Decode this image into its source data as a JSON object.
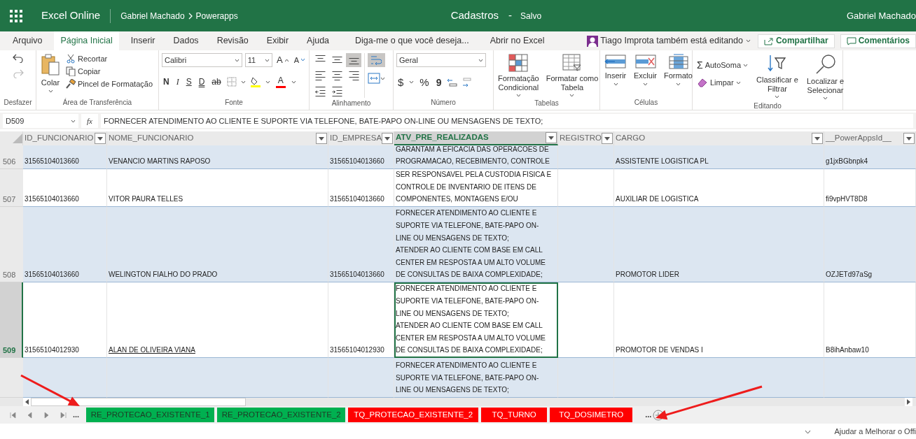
{
  "app_bar": {
    "app_name": "Excel Online",
    "breadcrumb": [
      "Gabriel Machado",
      "Powerapps"
    ],
    "document": "Cadastros",
    "separator": "-",
    "save_status": "Salvo",
    "user": "Gabriel Machado"
  },
  "menu_tabs": [
    {
      "label": "Arquivo",
      "selected": false
    },
    {
      "label": "Página Inicial",
      "selected": true
    },
    {
      "label": "Inserir",
      "selected": false
    },
    {
      "label": "Dados",
      "selected": false
    },
    {
      "label": "Revisão",
      "selected": false
    },
    {
      "label": "Exibir",
      "selected": false
    },
    {
      "label": "Ajuda",
      "selected": false
    }
  ],
  "tell_me": "Diga-me o que você deseja...",
  "open_in_desktop": "Abrir no Excel",
  "coauthor": "Tiago Improta também está editando",
  "share_button": "Compartilhar",
  "comments_button": "Comentários",
  "ribbon": {
    "undo": {
      "group": "Desfazer"
    },
    "clipboard": {
      "paste": "Colar",
      "cut": "Recortar",
      "copy": "Copiar",
      "format_painter": "Pincel de Formatação",
      "group": "Área de Transferência"
    },
    "font": {
      "font_name": "Calibri",
      "font_size": "11",
      "grow": "A",
      "shrink": "A",
      "format_buttons": [
        "N",
        "I",
        "S",
        "D",
        "ab"
      ],
      "font_color": "A",
      "group": "Fonte"
    },
    "alignment": {
      "buttons": [
        {
          "kind": "top",
          "selected": false
        },
        {
          "kind": "middle",
          "selected": false
        },
        {
          "kind": "bottom",
          "selected": true
        },
        {
          "kind": "left",
          "selected": false
        },
        {
          "kind": "center",
          "selected": false
        },
        {
          "kind": "right",
          "selected": false
        },
        {
          "kind": "outdent",
          "selected": false
        },
        {
          "kind": "indent",
          "selected": false
        }
      ],
      "wrap_text_selected": true,
      "group": "Alinhamento"
    },
    "number": {
      "format": "Geral",
      "currency": "$",
      "percent": "%",
      "comma": "9",
      "group": "Número"
    },
    "tables": {
      "conditional": [
        "Formatação",
        "Condicional"
      ],
      "format_table": [
        "Formatar como",
        "Tabela"
      ],
      "group": "Tabelas"
    },
    "cells": {
      "insert": "Inserir",
      "delete": "Excluir",
      "format": "Formato",
      "group": "Células"
    },
    "editing": {
      "sum_symbol": "Σ",
      "autosum": "AutoSoma",
      "clear": "Limpar",
      "sort": [
        "Classificar e",
        "Filtrar"
      ],
      "find": [
        "Localizar e",
        "Selecionar"
      ],
      "group": "Editando"
    }
  },
  "formula_bar": {
    "name_box": "D509",
    "function_label": "fx",
    "formula": "FORNECER  ATENDIMENTO AO CLIENTE E SUPORTE VIA TELEFONE, BATE-PAPO ON-LINE OU MENSAGENS DE TEXTO;"
  },
  "table": {
    "columns": [
      {
        "label": "ID_FUNCIONARIO",
        "selected": false
      },
      {
        "label": "NOME_FUNCIONARIO",
        "selected": false
      },
      {
        "label": "ID_EMPRESA",
        "selected": false
      },
      {
        "label": "ATV_PRE_REALIZADAS",
        "selected": true
      },
      {
        "label": "REGISTRO",
        "selected": false
      },
      {
        "label": "CARGO",
        "selected": false
      },
      {
        "label": "__PowerAppsId__",
        "selected": false
      }
    ],
    "rows": [
      {
        "number": "506",
        "selected": false,
        "shaded": true,
        "cells": [
          {
            "lines": [
              "31565104013660"
            ],
            "underlined": false,
            "selected": false
          },
          {
            "lines": [
              "VENANCIO MARTINS RAPOSO"
            ],
            "underlined": false,
            "selected": false
          },
          {
            "lines": [
              "31565104013660"
            ],
            "underlined": false,
            "selected": false
          },
          {
            "lines": [
              "GARANTAM A EFICACIA DAS OPERACOES DE",
              "PROGRAMACAO, RECEBIMENTO, CONTROLE"
            ],
            "underlined": false,
            "selected": false
          },
          null,
          {
            "lines": [
              "ASSISTENTE LOGISTICA PL"
            ],
            "underlined": false,
            "selected": false
          },
          {
            "lines": [
              "g1jxBGbnpk4"
            ],
            "underlined": false,
            "selected": false
          }
        ]
      },
      {
        "number": "507",
        "selected": false,
        "shaded": false,
        "cells": [
          {
            "lines": [
              "31565104013660"
            ],
            "underlined": false,
            "selected": false
          },
          {
            "lines": [
              "VITOR PAURA TELLES"
            ],
            "underlined": false,
            "selected": false
          },
          {
            "lines": [
              "31565104013660"
            ],
            "underlined": false,
            "selected": false
          },
          {
            "lines": [
              "SER RESPONSAVEL PELA CUSTODIA FISICA E",
              "CONTROLE DE INVENTARIO DE ITENS DE",
              "COMPONENTES, MONTAGENS E/OU"
            ],
            "underlined": false,
            "selected": false
          },
          null,
          {
            "lines": [
              "AUXILIAR DE LOGISTICA"
            ],
            "underlined": false,
            "selected": false
          },
          {
            "lines": [
              "fi9vpHVT8D8"
            ],
            "underlined": false,
            "selected": false
          }
        ]
      },
      {
        "number": "508",
        "selected": false,
        "shaded": true,
        "cells": [
          {
            "lines": [
              "31565104013660"
            ],
            "underlined": false,
            "selected": false
          },
          {
            "lines": [
              "WELINGTON FIALHO DO PRADO"
            ],
            "underlined": false,
            "selected": false
          },
          {
            "lines": [
              "31565104013660"
            ],
            "underlined": false,
            "selected": false
          },
          {
            "lines": [
              "FORNECER  ATENDIMENTO AO CLIENTE E",
              "SUPORTE VIA TELEFONE, BATE-PAPO ON-",
              "LINE OU MENSAGENS DE TEXTO;",
              "ATENDER AO CLIENTE COM BASE EM CALL",
              "CENTER EM RESPOSTA A UM ALTO VOLUME",
              "DE CONSULTAS DE BAIXA COMPLEXIDADE;"
            ],
            "underlined": false,
            "selected": false
          },
          null,
          {
            "lines": [
              "PROMOTOR LIDER"
            ],
            "underlined": false,
            "selected": false
          },
          {
            "lines": [
              "OZJETd97aSg"
            ],
            "underlined": false,
            "selected": false
          }
        ]
      },
      {
        "number": "509",
        "selected": true,
        "shaded": false,
        "cells": [
          {
            "lines": [
              "31565104012930"
            ],
            "underlined": false,
            "selected": false
          },
          {
            "lines": [
              "ALAN DE OLIVEIRA VIANA"
            ],
            "underlined": true,
            "selected": false
          },
          {
            "lines": [
              "31565104012930"
            ],
            "underlined": false,
            "selected": false
          },
          {
            "lines": [
              "FORNECER  ATENDIMENTO AO CLIENTE E",
              "SUPORTE VIA TELEFONE, BATE-PAPO ON-",
              "LINE OU MENSAGENS DE TEXTO;",
              "ATENDER AO CLIENTE COM BASE EM CALL",
              "CENTER EM RESPOSTA A UM ALTO VOLUME",
              "DE CONSULTAS DE BAIXA COMPLEXIDADE;"
            ],
            "underlined": false,
            "selected": true
          },
          null,
          {
            "lines": [
              "PROMOTOR DE VENDAS I"
            ],
            "underlined": false,
            "selected": false
          },
          {
            "lines": [
              "B8ihAnbaw10"
            ],
            "underlined": false,
            "selected": false
          }
        ]
      },
      {
        "selected": false,
        "shaded": true,
        "cells": [
          null,
          null,
          null,
          {
            "lines": [
              "FORNECER  ATENDIMENTO AO CLIENTE E",
              "SUPORTE VIA TELEFONE, BATE-PAPO ON-",
              "LINE OU MENSAGENS DE TEXTO;"
            ],
            "underlined": false,
            "selected": false
          },
          null,
          null,
          null
        ]
      }
    ]
  },
  "sheet_tabs": {
    "more_before": "...",
    "tabs": [
      {
        "label": "RE_PROTECAO_EXISTENTE_1",
        "color": "#00b050"
      },
      {
        "label": "RE_PROTECAO_EXISTENTE_2",
        "color": "#00b050"
      },
      {
        "label": "TQ_PROTECAO_EXISTENTE_2",
        "color": "#ff0000"
      },
      {
        "label": "TQ_TURNO",
        "color": "#ff0000"
      },
      {
        "label": "TQ_DOSIMETRO",
        "color": "#ff0000"
      }
    ],
    "more_after": "..."
  },
  "status_bar": {
    "feedback": "Ajudar a Melhorar o Offi"
  }
}
